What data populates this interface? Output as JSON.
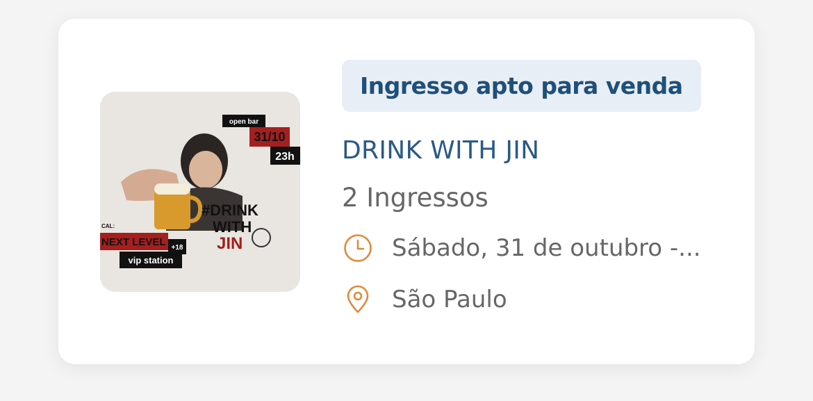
{
  "event": {
    "status_badge": "Ingresso apto para venda",
    "name": "DRINK WITH JIN",
    "tickets": "2 Ingressos",
    "date": "Sábado, 31 de outubro -...",
    "location": "São Paulo"
  },
  "poster": {
    "top_tag": "open bar",
    "date_tag": "31/10",
    "time_tag": "23h",
    "title_line1": "#DRINK",
    "title_line2": "WITH",
    "title_line3": "JIN",
    "venue_prefix": "CAL:",
    "venue": "NEXT LEVEL",
    "age": "+18",
    "sub_venue": "vip station"
  },
  "icons": {
    "date": "clock-icon",
    "location": "map-pin-icon"
  },
  "colors": {
    "accent_blue": "#2a5a86",
    "badge_bg": "#e8eef5",
    "icon_orange": "#e08a3c",
    "poster_red": "#a3201f"
  }
}
